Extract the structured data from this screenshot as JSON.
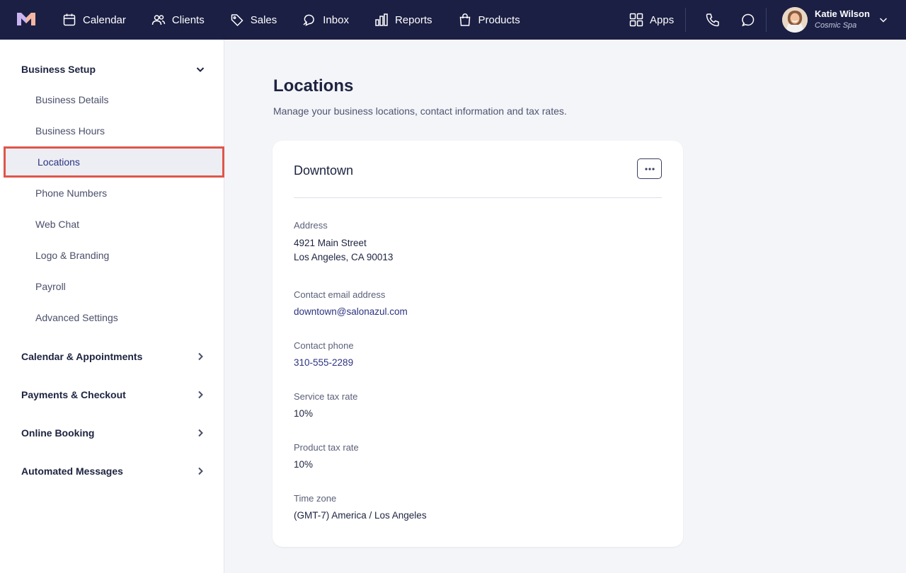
{
  "nav": {
    "items": [
      {
        "label": "Calendar",
        "icon": "calendar-icon"
      },
      {
        "label": "Clients",
        "icon": "users-icon"
      },
      {
        "label": "Sales",
        "icon": "tag-icon"
      },
      {
        "label": "Inbox",
        "icon": "inbox-icon"
      },
      {
        "label": "Reports",
        "icon": "bar-chart-icon"
      },
      {
        "label": "Products",
        "icon": "shopping-bag-icon"
      }
    ],
    "apps_label": "Apps",
    "user": {
      "name": "Katie Wilson",
      "org": "Cosmic Spa"
    }
  },
  "sidebar": {
    "sections": [
      {
        "label": "Business Setup",
        "expanded": true
      },
      {
        "label": "Calendar & Appointments",
        "expanded": false
      },
      {
        "label": "Payments & Checkout",
        "expanded": false
      },
      {
        "label": "Online Booking",
        "expanded": false
      },
      {
        "label": "Automated Messages",
        "expanded": false
      }
    ],
    "business_setup_items": [
      {
        "label": "Business Details"
      },
      {
        "label": "Business Hours"
      },
      {
        "label": "Locations",
        "active": true
      },
      {
        "label": "Phone Numbers"
      },
      {
        "label": "Web Chat"
      },
      {
        "label": "Logo & Branding"
      },
      {
        "label": "Payroll"
      },
      {
        "label": "Advanced Settings"
      }
    ]
  },
  "main": {
    "title": "Locations",
    "subtitle": "Manage your business locations, contact information and tax rates.",
    "location": {
      "name": "Downtown",
      "address_label": "Address",
      "address_line1": "4921 Main Street",
      "address_line2": "Los Angeles, CA 90013",
      "email_label": "Contact email address",
      "email": "downtown@salonazul.com",
      "phone_label": "Contact phone",
      "phone": "310-555-2289",
      "service_tax_label": "Service tax rate",
      "service_tax": "10%",
      "product_tax_label": "Product tax rate",
      "product_tax": "10%",
      "timezone_label": "Time zone",
      "timezone": "(GMT-7) America / Los Angeles"
    }
  },
  "colors": {
    "topbar": "#1b1f44",
    "active_outline": "#e0554a",
    "link": "#2c3280"
  }
}
